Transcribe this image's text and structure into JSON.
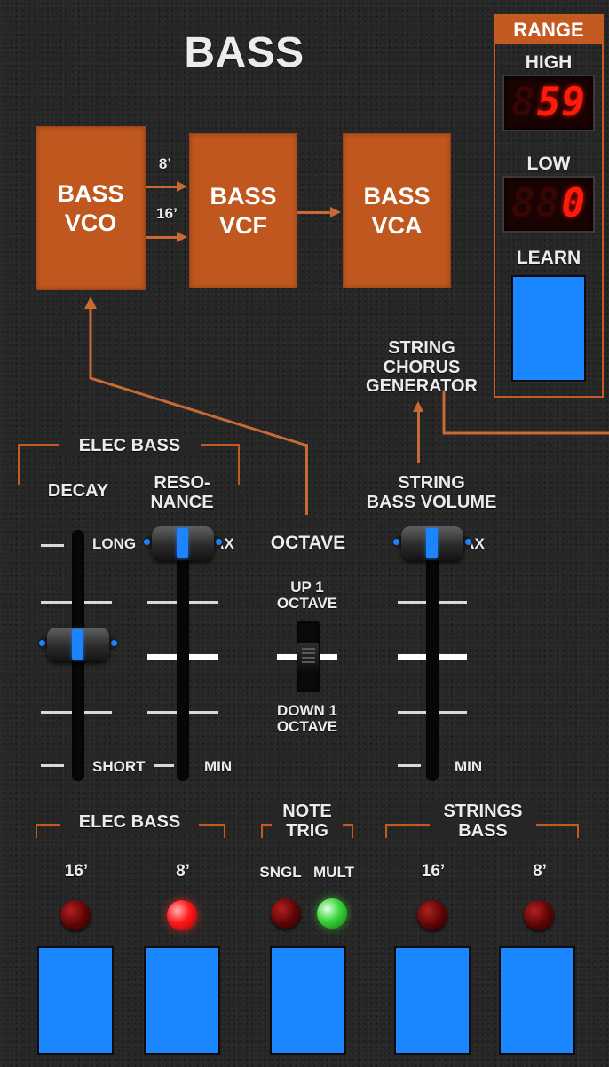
{
  "panel": {
    "title": "BASS"
  },
  "signal_flow": {
    "vco": "BASS\nVCO",
    "vcf": "BASS\nVCF",
    "vca": "BASS\nVCA",
    "route_8": "8’",
    "route_16": "16’",
    "chorus": "STRING\nCHORUS\nGENERATOR"
  },
  "range": {
    "header": "RANGE",
    "high_label": "HIGH",
    "high_value": "59",
    "low_label": "LOW",
    "low_value": "0",
    "learn_label": "LEARN"
  },
  "sliders": {
    "group_label": "ELEC BASS",
    "decay": {
      "label": "DECAY",
      "top_label": "LONG",
      "bottom_label": "SHORT",
      "value": 0.5
    },
    "resonance": {
      "label": "RESO-\nNANCE",
      "top_label": "MAX",
      "bottom_label": "MIN",
      "value": 1.0
    },
    "octave": {
      "label": "OCTAVE",
      "up_label": "UP 1\nOCTAVE",
      "down_label": "DOWN 1\nOCTAVE",
      "position": "center"
    },
    "string_volume": {
      "label": "STRING\nBASS VOLUME",
      "top_label": "MAX",
      "bottom_label": "MIN",
      "value": 1.0
    }
  },
  "buttons": {
    "elec_bass_group": "ELEC BASS",
    "note_trig_group": "NOTE\nTRIG",
    "strings_bass_group": "STRINGS\nBASS",
    "elec_16": {
      "label": "16’",
      "led": "off"
    },
    "elec_8": {
      "label": "8’",
      "led": "red"
    },
    "trig_sngl": {
      "label": "SNGL",
      "led": "off"
    },
    "trig_mult": {
      "label": "MULT",
      "led": "green"
    },
    "str_16": {
      "label": "16’",
      "led": "off"
    },
    "str_8": {
      "label": "8’",
      "led": "off"
    }
  },
  "colors": {
    "accent": "#c0571f",
    "pad": "#1a86ff",
    "display": "#ff1a0a",
    "panel": "#262626"
  }
}
